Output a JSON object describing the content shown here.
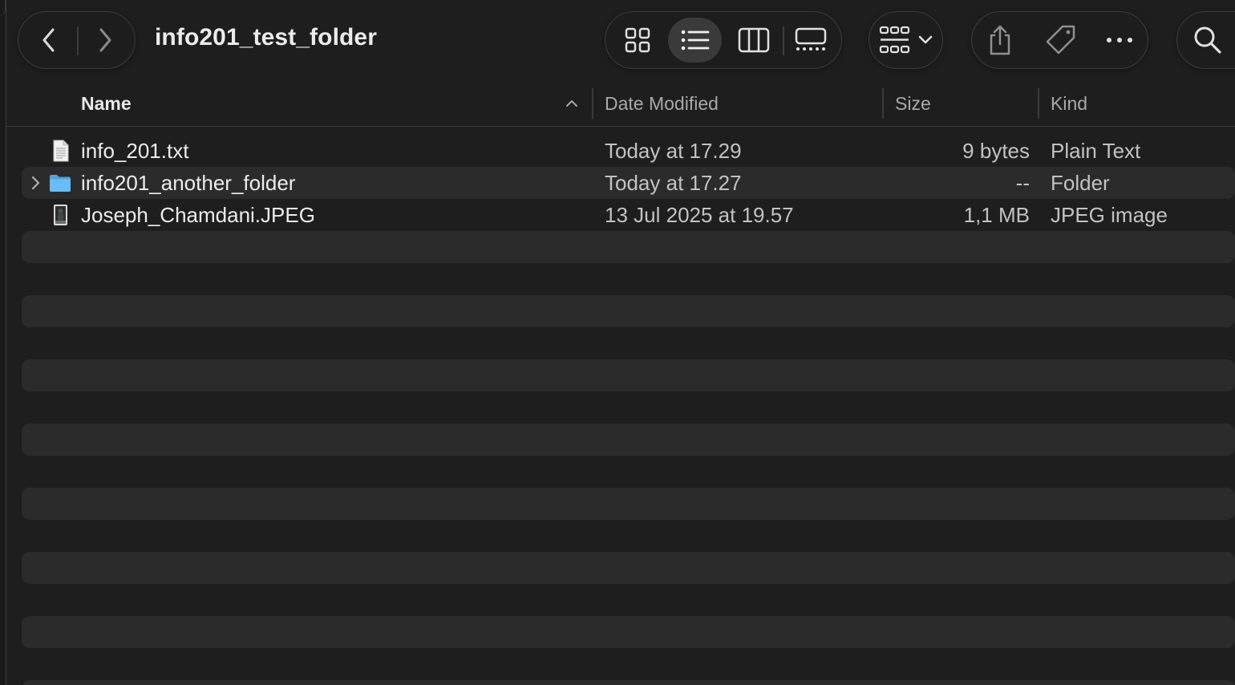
{
  "window": {
    "title": "info201_test_folder"
  },
  "toolbar": {
    "nav": {
      "back_icon": "chevron-left-icon",
      "forward_icon": "chevron-right-icon"
    },
    "views": [
      "icon-view-icon",
      "list-view-icon",
      "column-view-icon",
      "gallery-view-icon"
    ],
    "active_view": "list",
    "group_icon": "group-by-icon",
    "actions": [
      "share-icon",
      "tag-icon",
      "more-icon"
    ],
    "search_icon": "search-icon"
  },
  "columns": {
    "name": "Name",
    "date": "Date Modified",
    "size": "Size",
    "kind": "Kind"
  },
  "files": [
    {
      "name": "info_201.txt",
      "date": "Today at 17.29",
      "size": "9 bytes",
      "kind": "Plain Text",
      "icon": "text-file-icon"
    },
    {
      "name": "info201_another_folder",
      "date": "Today at 17.27",
      "size": "--",
      "kind": "Folder",
      "icon": "folder-icon"
    },
    {
      "name": "Joseph_Chamdani.JPEG",
      "date": "13 Jul 2025 at 19.57",
      "size": "1,1 MB",
      "kind": "JPEG image",
      "icon": "image-file-icon"
    }
  ],
  "colors": {
    "background": "#1e1e1e",
    "row_alt": "#2b2b2b",
    "folder_blue": "#5fb2ec"
  }
}
